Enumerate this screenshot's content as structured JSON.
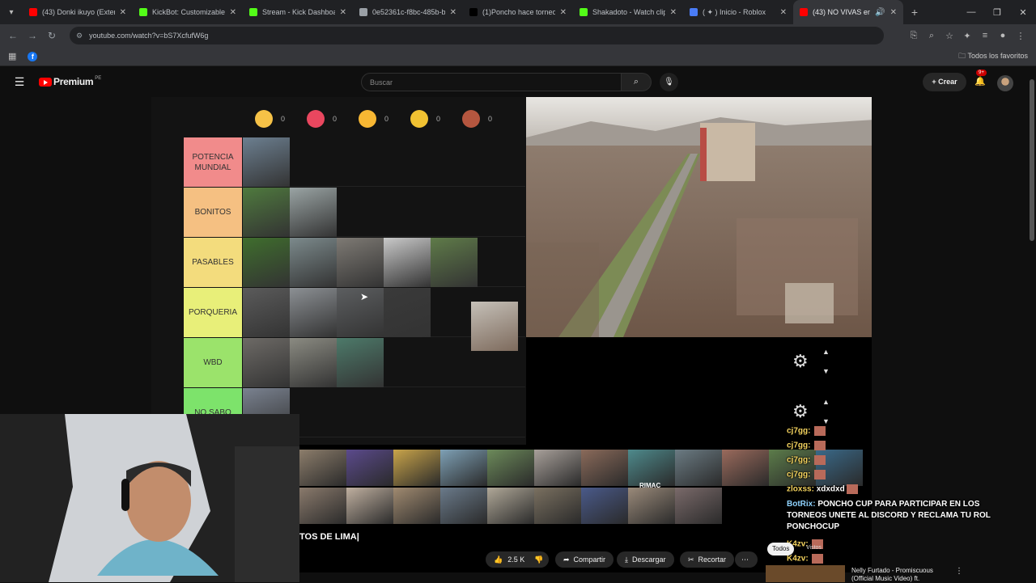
{
  "tabs": [
    {
      "title": "(43) Donki ikuyo (Extende",
      "fav": "#ff0000",
      "active": false
    },
    {
      "title": "KickBot: Customizable Ch",
      "fav": "#53fc18",
      "active": false
    },
    {
      "title": "Stream - Kick Dashboard",
      "fav": "#53fc18",
      "active": false
    },
    {
      "title": "0e52361c-f8bc-485b-bca",
      "fav": "#9aa0a6",
      "active": false
    },
    {
      "title": "(1)Poncho hace torneos d",
      "fav": "#000000",
      "active": false
    },
    {
      "title": "Shakadoto - Watch clips",
      "fav": "#53fc18",
      "active": false
    },
    {
      "title": "( ✦ ) Inicio - Roblox",
      "fav": "#4a7cf6",
      "active": false
    },
    {
      "title": "(43) NO VIVAS en est",
      "fav": "#ff0000",
      "active": true
    }
  ],
  "addressbar": {
    "url": "youtube.com/watch?v=bS7XcfufW6g"
  },
  "bookmarks": {
    "all_label": "Todos los favoritos",
    "fb": "f"
  },
  "youtube": {
    "logo": "Premium",
    "country": "PE",
    "search_placeholder": "Buscar",
    "create_label": "Crear",
    "notif_count": "9+"
  },
  "emoji_counts": [
    {
      "count": "0",
      "color": "#f6c247"
    },
    {
      "count": "0",
      "color": "#e9475f"
    },
    {
      "count": "0",
      "color": "#f7b733"
    },
    {
      "count": "0",
      "color": "#f1c232"
    },
    {
      "count": "0",
      "color": "#b5563f"
    }
  ],
  "tiers": [
    {
      "label": "POTENCIA MUNDIAL",
      "color": "#f18b8b",
      "images": [
        "#6c7f90"
      ]
    },
    {
      "label": "BONITOS",
      "color": "#f5c082",
      "images": [
        "#4f7a3e",
        "#9aa4a4"
      ]
    },
    {
      "label": "PASABLES",
      "color": "#f3dc7d",
      "images": [
        "#3f6e2d",
        "#7c8a8c",
        "#7e7a74",
        "#c9c9c9",
        "#5f7b49"
      ]
    },
    {
      "label": "PORQUERIA",
      "color": "#e8ef79",
      "images": [
        "#5b5b5b",
        "#8c9094",
        "#5c5e60",
        "#3a3a3a"
      ]
    },
    {
      "label": "WBD",
      "color": "#9be36b",
      "images": [
        "#6d6a66",
        "#8b8b82",
        "#4d7a6a"
      ]
    },
    {
      "label": "NO SABO",
      "color": "#7de36b",
      "images": [
        "#7a8290"
      ]
    }
  ],
  "strip_label": "RIMAC",
  "video_title": "TOS DE LIMA|",
  "actions": {
    "likes": "2.5 K",
    "share": "Compartir",
    "download": "Descargar",
    "clip": "Recortar"
  },
  "chat": [
    {
      "user": "cj7gg:",
      "text": ""
    },
    {
      "user": "cj7gg:",
      "text": ""
    },
    {
      "user": "cj7gg:",
      "text": ""
    },
    {
      "user": "cj7gg:",
      "text": ""
    },
    {
      "user": "zloxss:",
      "text": "xdxdxd"
    }
  ],
  "bot": {
    "user": "BotRix:",
    "text": "PONCHO CUP PARA PARTICIPAR EN LOS TORNEOS UNETE AL DISCORD Y RECLAMA TU ROL PONCHOCUP"
  },
  "chat_tail": [
    {
      "user": "K4zv:",
      "text": ""
    },
    {
      "user": "K4zv:",
      "text": ""
    },
    {
      "user": "K4zv:",
      "text": ""
    }
  ],
  "chip_label": "Todos",
  "chip_label_2": "Vistos",
  "recommendation": {
    "title": "Nelly Furtado - Promiscuous (Official Music Video) ft."
  }
}
